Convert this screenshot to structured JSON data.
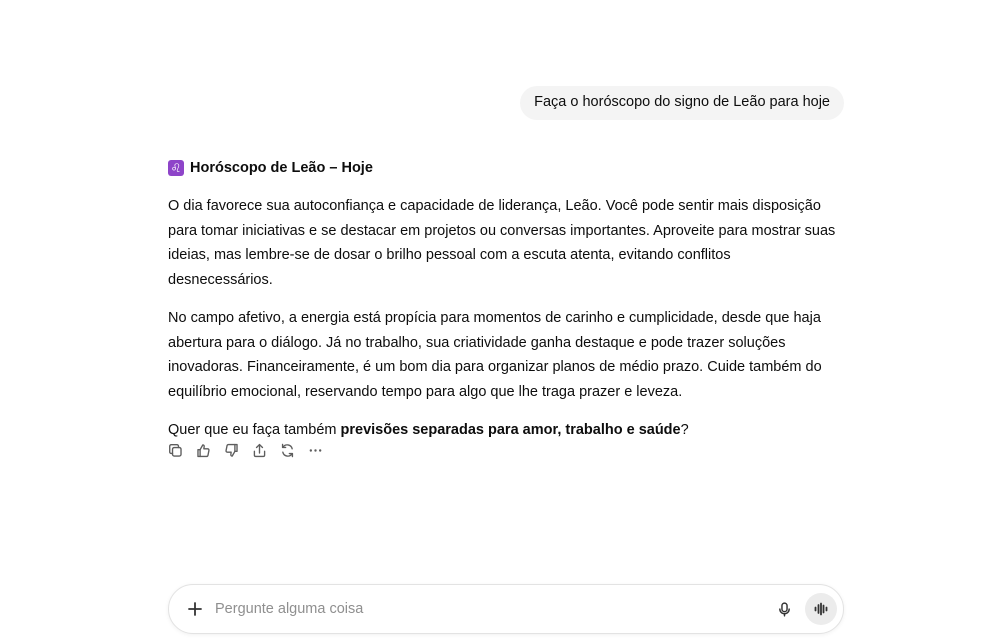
{
  "user_message": "Faça o horóscopo do signo de Leão para hoje",
  "reply": {
    "heading_icon": "♌",
    "heading": "Horóscopo de Leão – Hoje",
    "paragraph1": "O dia favorece sua autoconfiança e capacidade de liderança, Leão. Você pode sentir mais disposição para tomar iniciativas e se destacar em projetos ou conversas importantes. Aproveite para mostrar suas ideias, mas lembre-se de dosar o brilho pessoal com a escuta atenta, evitando conflitos desnecessários.",
    "paragraph2": "No campo afetivo, a energia está propícia para momentos de carinho e cumplicidade, desde que haja abertura para o diálogo. Já no trabalho, sua criatividade ganha destaque e pode trazer soluções inovadoras. Financeiramente, é um bom dia para organizar planos de médio prazo. Cuide também do equilíbrio emocional, reservando tempo para algo que lhe traga prazer e leveza.",
    "question_prefix": "Quer que eu faça também ",
    "question_bold": "previsões separadas para amor, trabalho e saúde",
    "question_suffix": "?"
  },
  "actions": [
    "copy-icon",
    "thumbs-up-icon",
    "thumbs-down-icon",
    "share-icon",
    "regenerate-icon",
    "more-icon"
  ],
  "composer": {
    "placeholder": "Pergunte alguma coisa",
    "value": ""
  },
  "colors": {
    "bubble_bg": "#f4f4f4",
    "leo_badge": "#8e44c9",
    "icon_gray": "#5d5d5d"
  }
}
